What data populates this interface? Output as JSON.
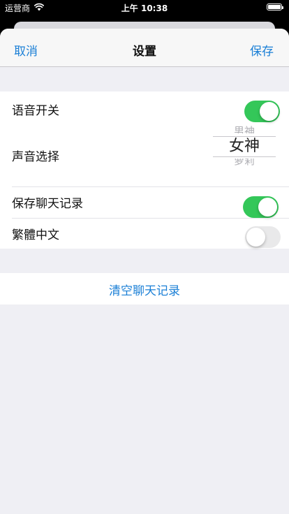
{
  "status_bar": {
    "carrier": "运营商",
    "time": "上午 10:38",
    "wifi_icon": "wifi-icon",
    "battery_icon": "battery-icon"
  },
  "nav": {
    "cancel_label": "取消",
    "title": "设置",
    "save_label": "保存"
  },
  "settings": {
    "voice_switch": {
      "label": "语音开关",
      "on": true
    },
    "voice_select": {
      "label": "声音选择",
      "options": [
        "男神",
        "女神",
        "萝莉"
      ],
      "selected": "女神"
    },
    "save_history": {
      "label": "保存聊天记录",
      "on": true
    },
    "traditional_chinese": {
      "label": "繁體中文",
      "on": false
    }
  },
  "actions": {
    "clear_history_label": "清空聊天记录"
  },
  "colors": {
    "accent": "#1a7fd6",
    "switch_on": "#34c759",
    "switch_off": "#e9e9ea",
    "grouped_background": "#efeff4"
  }
}
